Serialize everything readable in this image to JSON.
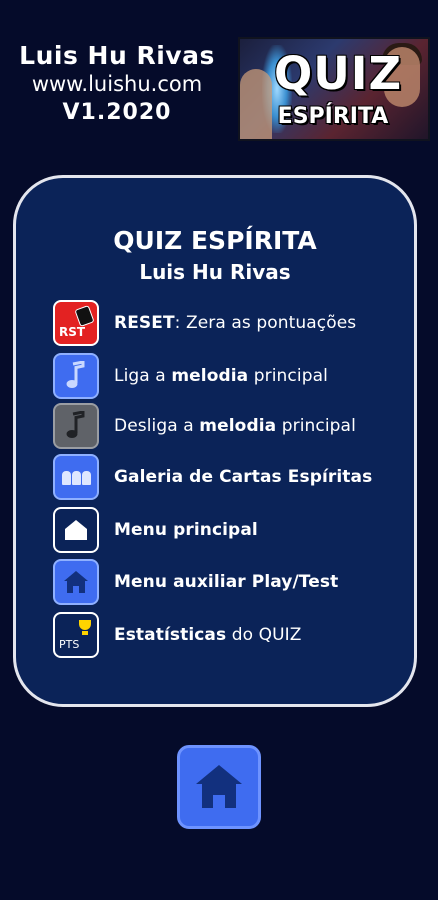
{
  "header": {
    "author": "Luis Hu Rivas",
    "website": "www.luishu.com",
    "version": "V1.2020"
  },
  "logo": {
    "line1": "QUIZ",
    "line2": "ESPÍRITA"
  },
  "panel": {
    "title": "QUIZ ESPÍRITA",
    "subtitle": "Luis Hu Rivas",
    "items": [
      {
        "icon": "reset-icon",
        "icon_text": "RST",
        "bold": "RESET",
        "text": ": Zera as pontuações"
      },
      {
        "icon": "music-note-icon",
        "pre": "Liga a ",
        "bold": "melodia",
        "post": " principal"
      },
      {
        "icon": "music-note-off-icon",
        "pre": "Desliga a ",
        "bold": "melodia",
        "post": " principal"
      },
      {
        "icon": "cards-gallery-icon",
        "bold": "Galeria de Cartas Espíritas"
      },
      {
        "icon": "home-icon",
        "bold": "Menu principal"
      },
      {
        "icon": "home-auxiliary-icon",
        "bold": "Menu auxiliar Play/Test"
      },
      {
        "icon": "statistics-trophy-icon",
        "icon_text": "PTS",
        "bold": "Estatísticas",
        "post": " do QUIZ"
      }
    ]
  },
  "footer": {
    "home_button_icon": "home-icon"
  },
  "colors": {
    "background": "#050b2a",
    "panel": "#0b2358",
    "panel_border": "#e4e6ee",
    "button_blue": "#3f6cf0",
    "reset_red": "#e32222",
    "gray": "#5f6268",
    "trophy": "#ffd400"
  }
}
